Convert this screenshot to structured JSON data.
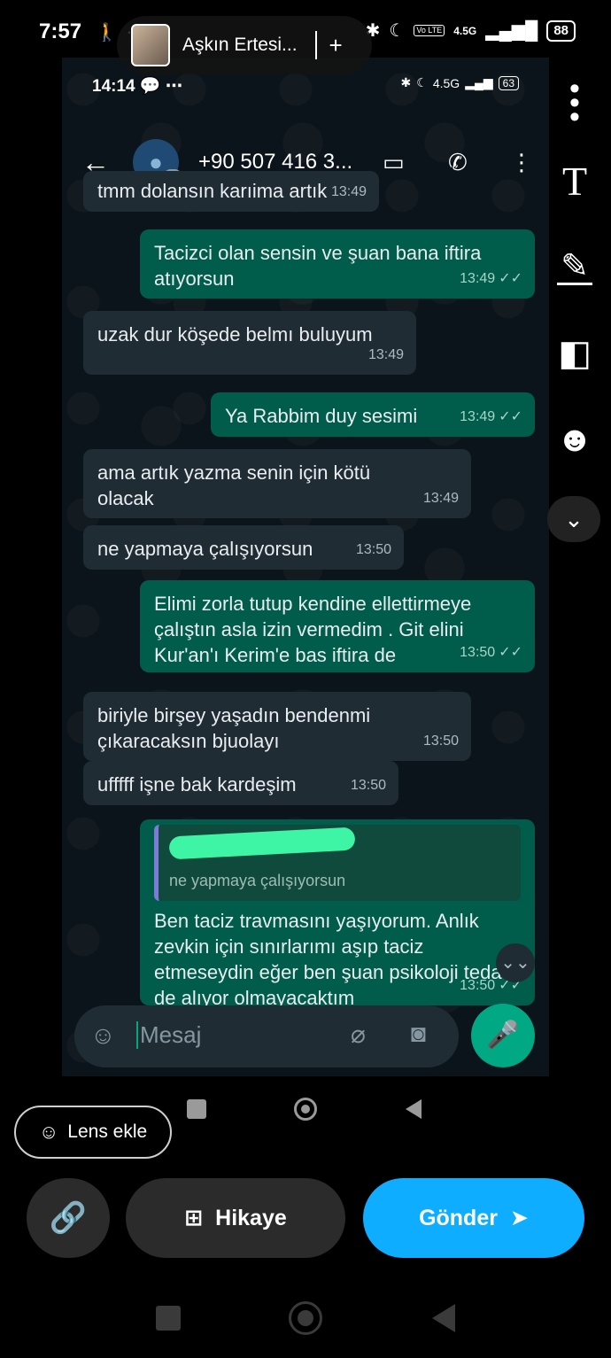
{
  "outer_status": {
    "time": "7:57",
    "battery": "88",
    "network": "4.5G",
    "volte": "Vo LTE"
  },
  "inner_status": {
    "time": "14:14",
    "battery": "63",
    "network": "4.5G"
  },
  "story": {
    "title": "Aşkın Ertesi...",
    "plus": "+"
  },
  "chat": {
    "contact": "+90 507 416 3..."
  },
  "messages": [
    {
      "dir": "in",
      "text": "tmm dolansın karıima artık",
      "time": "13:49"
    },
    {
      "dir": "out",
      "text": "Tacizci olan sensin ve şuan bana iftira atıyorsun",
      "time": "13:49"
    },
    {
      "dir": "in",
      "text": "uzak dur köşede belmı buluyum",
      "time": "13:49"
    },
    {
      "dir": "out",
      "text": "Ya Rabbim duy sesimi",
      "time": "13:49"
    },
    {
      "dir": "in",
      "text": "ama artık yazma senin için kötü olacak",
      "time": "13:49"
    },
    {
      "dir": "in",
      "text": "ne yapmaya çalışıyorsun",
      "time": "13:50"
    },
    {
      "dir": "out",
      "text": "Elimi zorla tutup kendine ellettirmeye çalıştın asla izin vermedim . Git elini Kur'an'ı Kerim'e bas iftira de",
      "time": "13:50"
    },
    {
      "dir": "in",
      "text": "biriyle birşey yaşadın bendenmi çıkaracaksın bjuolayı",
      "time": "13:50"
    },
    {
      "dir": "in",
      "text": "ufffff işne bak kardeşim",
      "time": "13:50"
    },
    {
      "dir": "out",
      "text": "Ben taciz travmasını yaşıyorum. Anlık zevkin için sınırlarımı aşıp taciz etmeseydin eğer ben şuan psikoloji tedavi de alıyor olmayacaktım",
      "time": "13:50",
      "quote": "ne yapmaya çalışıyorsun"
    }
  ],
  "input": {
    "placeholder": "Mesaj"
  },
  "buttons": {
    "lens": "Lens ekle",
    "story": "Hikaye",
    "send": "Gönder"
  },
  "icons": {
    "back": "←",
    "call": "✆",
    "video": "▭",
    "menu": "⋮",
    "emoji": "☺",
    "clip": "⌀",
    "camera": "◙",
    "mic": "🎤",
    "text_tool": "T",
    "pen": "✎",
    "sticker": "◧",
    "lens": "☻",
    "chevron": "⌄",
    "link": "🔗",
    "story_add": "⊞",
    "send": "➤",
    "scroll": "⌄⌄"
  },
  "colors": {
    "send_button": "#0fadff",
    "outgoing": "#005c4b",
    "incoming": "#202c33",
    "accent": "#00a884"
  }
}
